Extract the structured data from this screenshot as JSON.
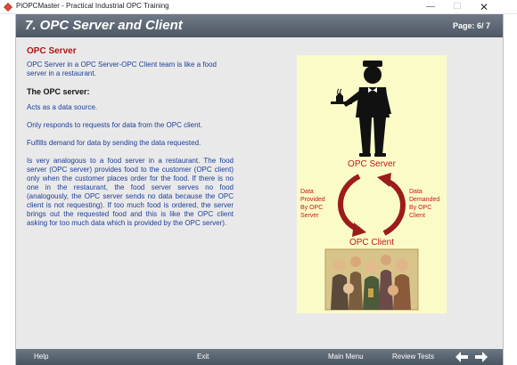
{
  "window": {
    "title": "PiOPCMaster - Practical Industrial OPC Training",
    "minimize_glyph": "—",
    "maximize_glyph": "☐",
    "close_glyph": "✕"
  },
  "header": {
    "title": "7. OPC Server and Client",
    "page_indicator": "Page:  6/ 7"
  },
  "content": {
    "section_heading": "OPC Server",
    "intro": "OPC Server in a OPC Server-OPC Client team is like a food server in a restaurant.",
    "subheading": "The OPC server:",
    "points": [
      "Acts as a data source.",
      "Only responds to requests for data from the OPC client.",
      "Fulfills demand for data by sending the data requested."
    ],
    "analogy": "Is very analogous to a food server in a restaurant.  The food server (OPC server) provides food to the customer (OPC client) only when the customer places order for the food.  If there is no one in the restaurant, the food server serves no food (analogously, the OPC server sends no data because the OPC client is not requesting).  If too much food is ordered, the server brings out the requested food and this is like the OPC client asking for too much data which is provided by the OPC server)."
  },
  "illustration": {
    "server_label": "OPC Server",
    "client_label": "OPC Client",
    "left_caption": [
      "Data",
      "Provided",
      "By OPC",
      "Server"
    ],
    "right_caption": [
      "Data",
      "Demanded",
      "By OPC",
      "Client"
    ],
    "colors": {
      "label_red": "#c41a1a",
      "arrow_red": "#9c1b1b",
      "background": "#fbfbc8"
    },
    "icons": [
      "waiter-icon",
      "cycle-arrows-icon",
      "customers-crowd-image"
    ]
  },
  "footer": {
    "help": "Help",
    "exit": "Exit",
    "main_menu": "Main Menu",
    "review_tests": "Review Tests",
    "prev_icon": "left-arrow-icon",
    "next_icon": "right-arrow-icon"
  }
}
